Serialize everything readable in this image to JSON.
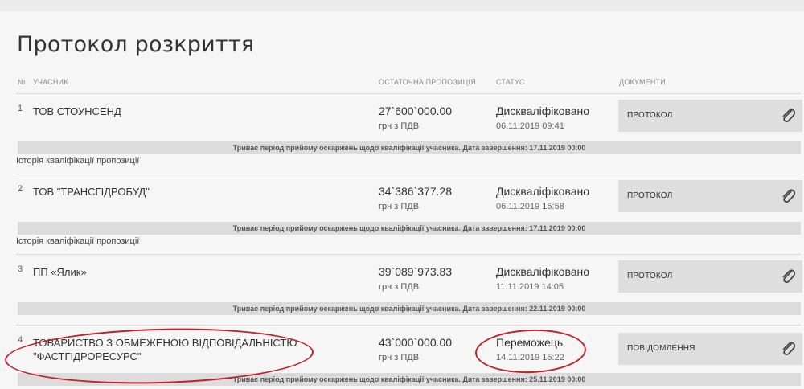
{
  "page": {
    "title": "Протокол розкриття"
  },
  "table": {
    "headers": {
      "number": "№",
      "participant": "Учасник",
      "final_offer": "Остаточна пропозиція",
      "status": "Статус",
      "documents": "Документи"
    },
    "rows": [
      {
        "number": "1",
        "name": "ТОВ СТОУНСЕНД",
        "price": "27`600`000.00",
        "vat": "грн з ПДВ",
        "status": "Дискваліфіковано",
        "date": "06.11.2019 09:41",
        "document": "Протокол",
        "notice": "Триває період прийому оскаржень щодо кваліфікації учасника. Дата завершення: 17.11.2019 00:00",
        "history": "Історія кваліфікації пропозиції"
      },
      {
        "number": "2",
        "name": "ТОВ \"ТРАНСГІДРОБУД\"",
        "price": "34`386`377.28",
        "vat": "грн з ПДВ",
        "status": "Дискваліфіковано",
        "date": "06.11.2019 15:58",
        "document": "Протокол",
        "notice": "Триває період прийому оскаржень щодо кваліфікації учасника. Дата завершення: 17.11.2019 00:00",
        "history": "Історія кваліфікації пропозиції"
      },
      {
        "number": "3",
        "name": "ПП «Ялик»",
        "price": "39`089`973.83",
        "vat": "грн з ПДВ",
        "status": "Дискваліфіковано",
        "date": "11.11.2019 14:05",
        "document": "Протокол",
        "notice": "Триває період прийому оскаржень щодо кваліфікації учасника. Дата завершення: 22.11.2019 00:00"
      },
      {
        "number": "4",
        "name": "ТОВАРИСТВО З ОБМЕЖЕНОЮ ВІДПОВІДАЛЬНІСТЮ \"ФАСТГІДРОРЕСУРС\"",
        "price": "43`000`000.00",
        "vat": "грн з ПДВ",
        "status": "Переможець",
        "date": "14.11.2019 15:22",
        "document": "Повідомлення",
        "notice": "Триває період прийому оскаржень щодо кваліфікації учасника. Дата завершення: 25.11.2019 00:00"
      }
    ]
  },
  "colors": {
    "annotation": "#c0222a",
    "doc_button_bg": "#dedede",
    "notice_bg": "#dcdcdc"
  },
  "icons": {
    "document_attachment": "paperclip-icon"
  }
}
